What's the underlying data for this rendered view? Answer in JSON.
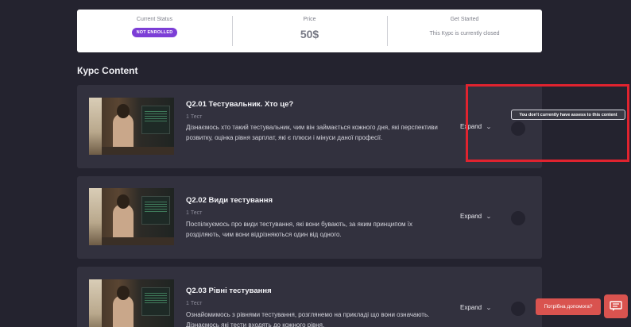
{
  "status_card": {
    "current_status_label": "Current Status",
    "status_badge": "NOT ENROLLED",
    "price_label": "Price",
    "price_value": "50$",
    "get_started_label": "Get Started",
    "get_started_text": "This Курс is currently closed"
  },
  "section_title": "Курс Content",
  "lessons": [
    {
      "title": "Q2.01 Тестувальник. Хто це?",
      "meta": "1 Тест",
      "description": "Дізнаємось хто такий тестувальник, чим він займається кожного дня, які перспективи розвитку, оцінка рівня зарплат, які є плюси і мінуси даної професії.",
      "expand_label": "Expand"
    },
    {
      "title": "Q2.02 Види тестування",
      "meta": "1 Тест",
      "description": "Поспілкуємось про види тестування, які вони бувають, за яким принципом їх розділяють, чим вони відрізняються один від одного.",
      "expand_label": "Expand"
    },
    {
      "title": "Q2.03 Рівні тестування",
      "meta": "1 Тест",
      "description": "Ознайомимось з рівнями тестування, розглянемо на прикладі що вони означають. Дізнаємось які тести входять до кожного рівня.",
      "expand_label": "Expand"
    }
  ],
  "tooltip_text": "You don't currently have assess to this content",
  "help_text": "Потрібна допомога?",
  "colors": {
    "page_bg": "#24232f",
    "card_bg": "#32313e",
    "badge": "#7c3ed6",
    "highlight": "#e0232f",
    "help": "#d9534f"
  }
}
